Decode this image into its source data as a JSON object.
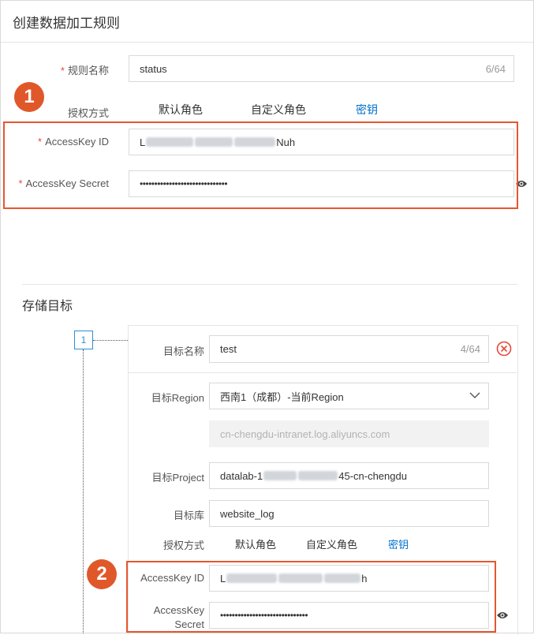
{
  "page": {
    "title": "创建数据加工规则"
  },
  "rule_name": {
    "label": "规则名称",
    "value": "status",
    "counter": "6/64"
  },
  "auth": {
    "label": "授权方式",
    "options": [
      "默认角色",
      "自定义角色",
      "密钥"
    ],
    "selected": "密钥"
  },
  "access_key_id": {
    "label": "AccessKey ID",
    "value_prefix": "L",
    "value_suffix": "Nuh"
  },
  "access_key_secret": {
    "label": "AccessKey Secret",
    "value": "••••••••••••••••••••••••••••••"
  },
  "storage": {
    "section_title": "存储目标",
    "step": "1",
    "target_name": {
      "label": "目标名称",
      "value": "test",
      "counter": "4/64"
    },
    "region": {
      "label": "目标Region",
      "value": "西南1（成都）-当前Region"
    },
    "endpoint": {
      "value": "cn-chengdu-intranet.log.aliyuncs.com"
    },
    "project": {
      "label": "目标Project",
      "value_prefix": "datalab-1",
      "value_suffix": "45-cn-chengdu"
    },
    "logstore": {
      "label": "目标库",
      "value": "website_log"
    },
    "auth": {
      "label": "授权方式",
      "options": [
        "默认角色",
        "自定义角色",
        "密钥"
      ],
      "selected": "密钥"
    },
    "access_key_id": {
      "label": "AccessKey ID",
      "value_prefix": "L",
      "value_suffix": "h"
    },
    "access_key_secret": {
      "label_line1": "AccessKey",
      "label_line2": "Secret",
      "value": "••••••••••••••••••••••••••••••"
    }
  },
  "annotations": {
    "badge1": "1",
    "badge2": "2"
  },
  "colors": {
    "accent": "#0070cc",
    "annotation": "#e5572f",
    "required": "#e5483a"
  }
}
